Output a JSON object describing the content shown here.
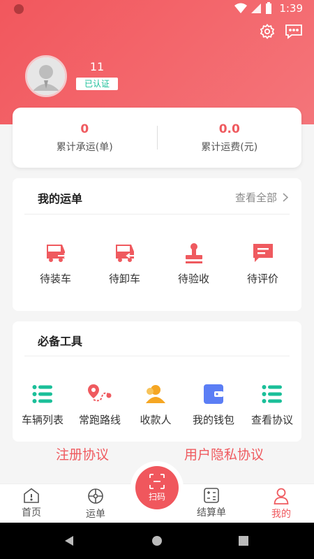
{
  "status_bar": {
    "time": "1:39"
  },
  "profile": {
    "name": "11",
    "verified_label": "已认证"
  },
  "stats": [
    {
      "value": "0",
      "label": "累计承运(单)"
    },
    {
      "value": "0.0",
      "label": "累计运费(元)"
    }
  ],
  "orders": {
    "title": "我的运单",
    "view_all": "查看全部",
    "items": [
      {
        "label": "待装车",
        "icon": "truck-load-icon"
      },
      {
        "label": "待卸车",
        "icon": "truck-unload-icon"
      },
      {
        "label": "待验收",
        "icon": "stamp-icon"
      },
      {
        "label": "待评价",
        "icon": "comment-icon"
      }
    ]
  },
  "tools": {
    "title": "必备工具",
    "items": [
      {
        "label": "车辆列表",
        "icon": "list-icon"
      },
      {
        "label": "常跑路线",
        "icon": "route-icon"
      },
      {
        "label": "收款人",
        "icon": "payee-icon"
      },
      {
        "label": "我的钱包",
        "icon": "wallet-icon"
      },
      {
        "label": "查看协议",
        "icon": "list-icon"
      }
    ]
  },
  "links": {
    "register": "注册协议",
    "privacy": "用户隐私协议"
  },
  "nav": {
    "home": "首页",
    "waybill": "运单",
    "scan": "扫码",
    "settlement": "结算单",
    "mine": "我的"
  },
  "colors": {
    "brand": "#ef5a5f",
    "teal": "#1bbf99",
    "orange": "#f5a623",
    "blue": "#5b7ef5"
  }
}
